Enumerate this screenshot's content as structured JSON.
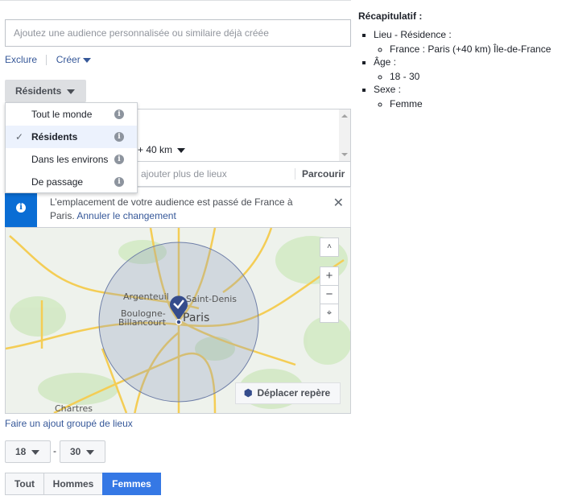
{
  "audience": {
    "placeholder": "Ajoutez une audience personnalisée ou similaire déjà créée",
    "exclude": "Exclure",
    "create": "Créer"
  },
  "location": {
    "type_button": "Résidents",
    "type_options": [
      {
        "label": "Tout le monde",
        "selected": false
      },
      {
        "label": "Résidents",
        "selected": true
      },
      {
        "label": "Dans les environs",
        "selected": false
      },
      {
        "label": "De passage",
        "selected": false
      }
    ],
    "radius": "+ 40 km",
    "search_placeholder": "ajouter plus de lieux",
    "browse": "Parcourir",
    "banner_text": "L’emplacement de votre audience est passé de France à Paris.",
    "banner_link": "Annuler le changement",
    "map": {
      "labels": [
        "Argenteuil",
        "Saint-Denis",
        "Boulogne-Billancourt",
        "Paris",
        "Chartres"
      ],
      "move_pin": "Déplacer repère"
    },
    "bulk_link": "Faire un ajout groupé de lieux"
  },
  "age": {
    "min": "18",
    "max": "30",
    "separator": "-"
  },
  "gender": {
    "options": [
      "Tout",
      "Hommes",
      "Femmes"
    ],
    "selected": "Femmes"
  },
  "summary": {
    "title": "Récapitulatif :",
    "items": [
      {
        "label": "Lieu - Résidence :",
        "sub": "France : Paris (+40 km) Île-de-France"
      },
      {
        "label": "Âge :",
        "sub": "18 - 30"
      },
      {
        "label": "Sexe :",
        "sub": "Femme"
      }
    ]
  },
  "colors": {
    "accent": "#3578e5",
    "link": "#365899",
    "banner": "#0a6dd4"
  }
}
